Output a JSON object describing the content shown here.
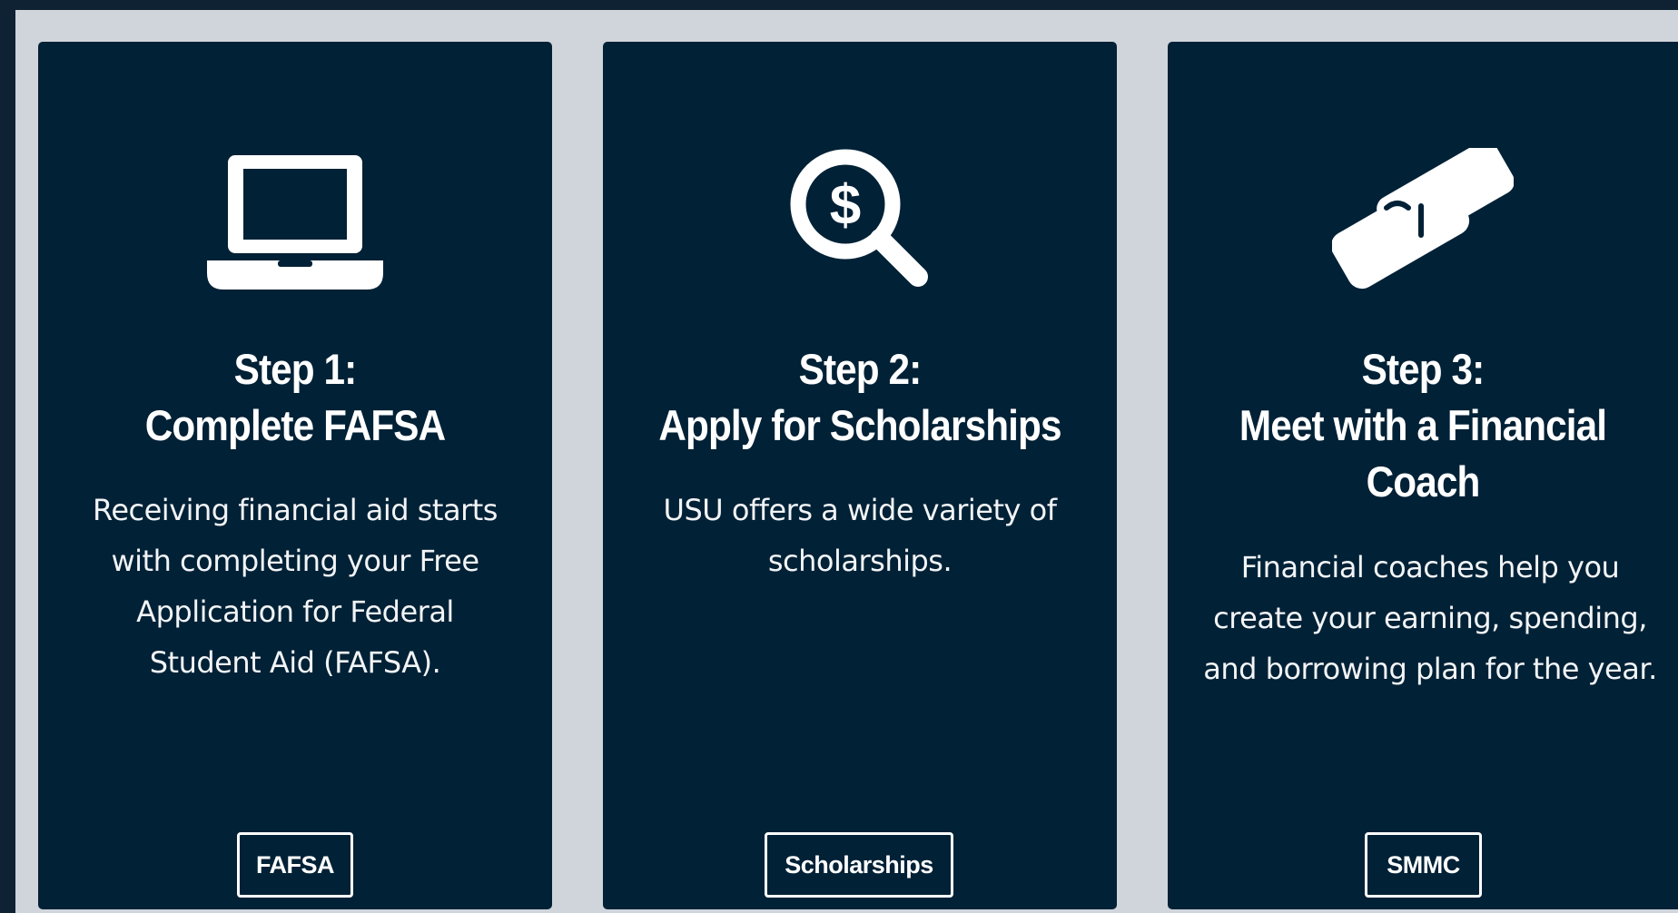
{
  "steps": [
    {
      "step_label": "Step 1:",
      "title": "Complete FAFSA",
      "title_line2": "",
      "description": "Receiving financial aid starts with completing your Free Application for Federal Student Aid (FAFSA).",
      "button_label": "FAFSA",
      "icon": "laptop-icon"
    },
    {
      "step_label": "Step 2:",
      "title": "Apply for Scholarships",
      "title_line2": "",
      "description": "USU offers a wide variety of scholarships.",
      "button_label": "Scholarships",
      "icon": "magnifier-dollar-icon"
    },
    {
      "step_label": "Step 3:",
      "title": "Meet with a Financial",
      "title_line2": "Coach",
      "description": "Financial coaches help you create your earning, spending, and borrowing plan for the year.",
      "button_label": "SMMC",
      "icon": "handshake-icon"
    }
  ],
  "colors": {
    "frame": "#0f2233",
    "panel": "#d0d5dc",
    "card": "#012136",
    "text": "#ffffff"
  }
}
